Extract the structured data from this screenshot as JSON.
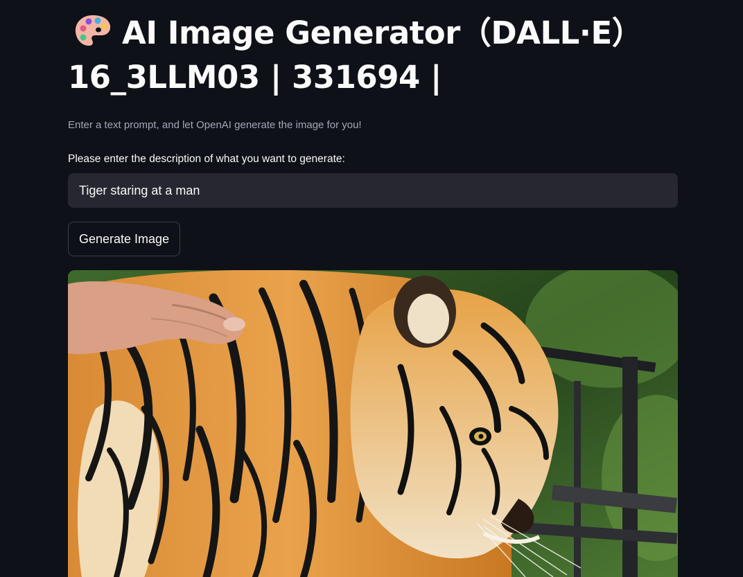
{
  "app": {
    "title_emoji_icon": "artist-palette-icon",
    "title_line1": "AI Image Generator（DALL·E）",
    "title_line2": "16_3LLM03 | 331694 |",
    "subtitle": "Enter a text prompt, and let OpenAI generate the image for you!"
  },
  "form": {
    "prompt_label": "Please enter the description of what you want to generate:",
    "prompt_value": "Tiger staring at a man",
    "generate_button_label": "Generate Image"
  },
  "colors": {
    "background": "#0e1117",
    "input_background": "#262730",
    "text": "#fafafa",
    "muted_text": "#a3a8b8"
  }
}
